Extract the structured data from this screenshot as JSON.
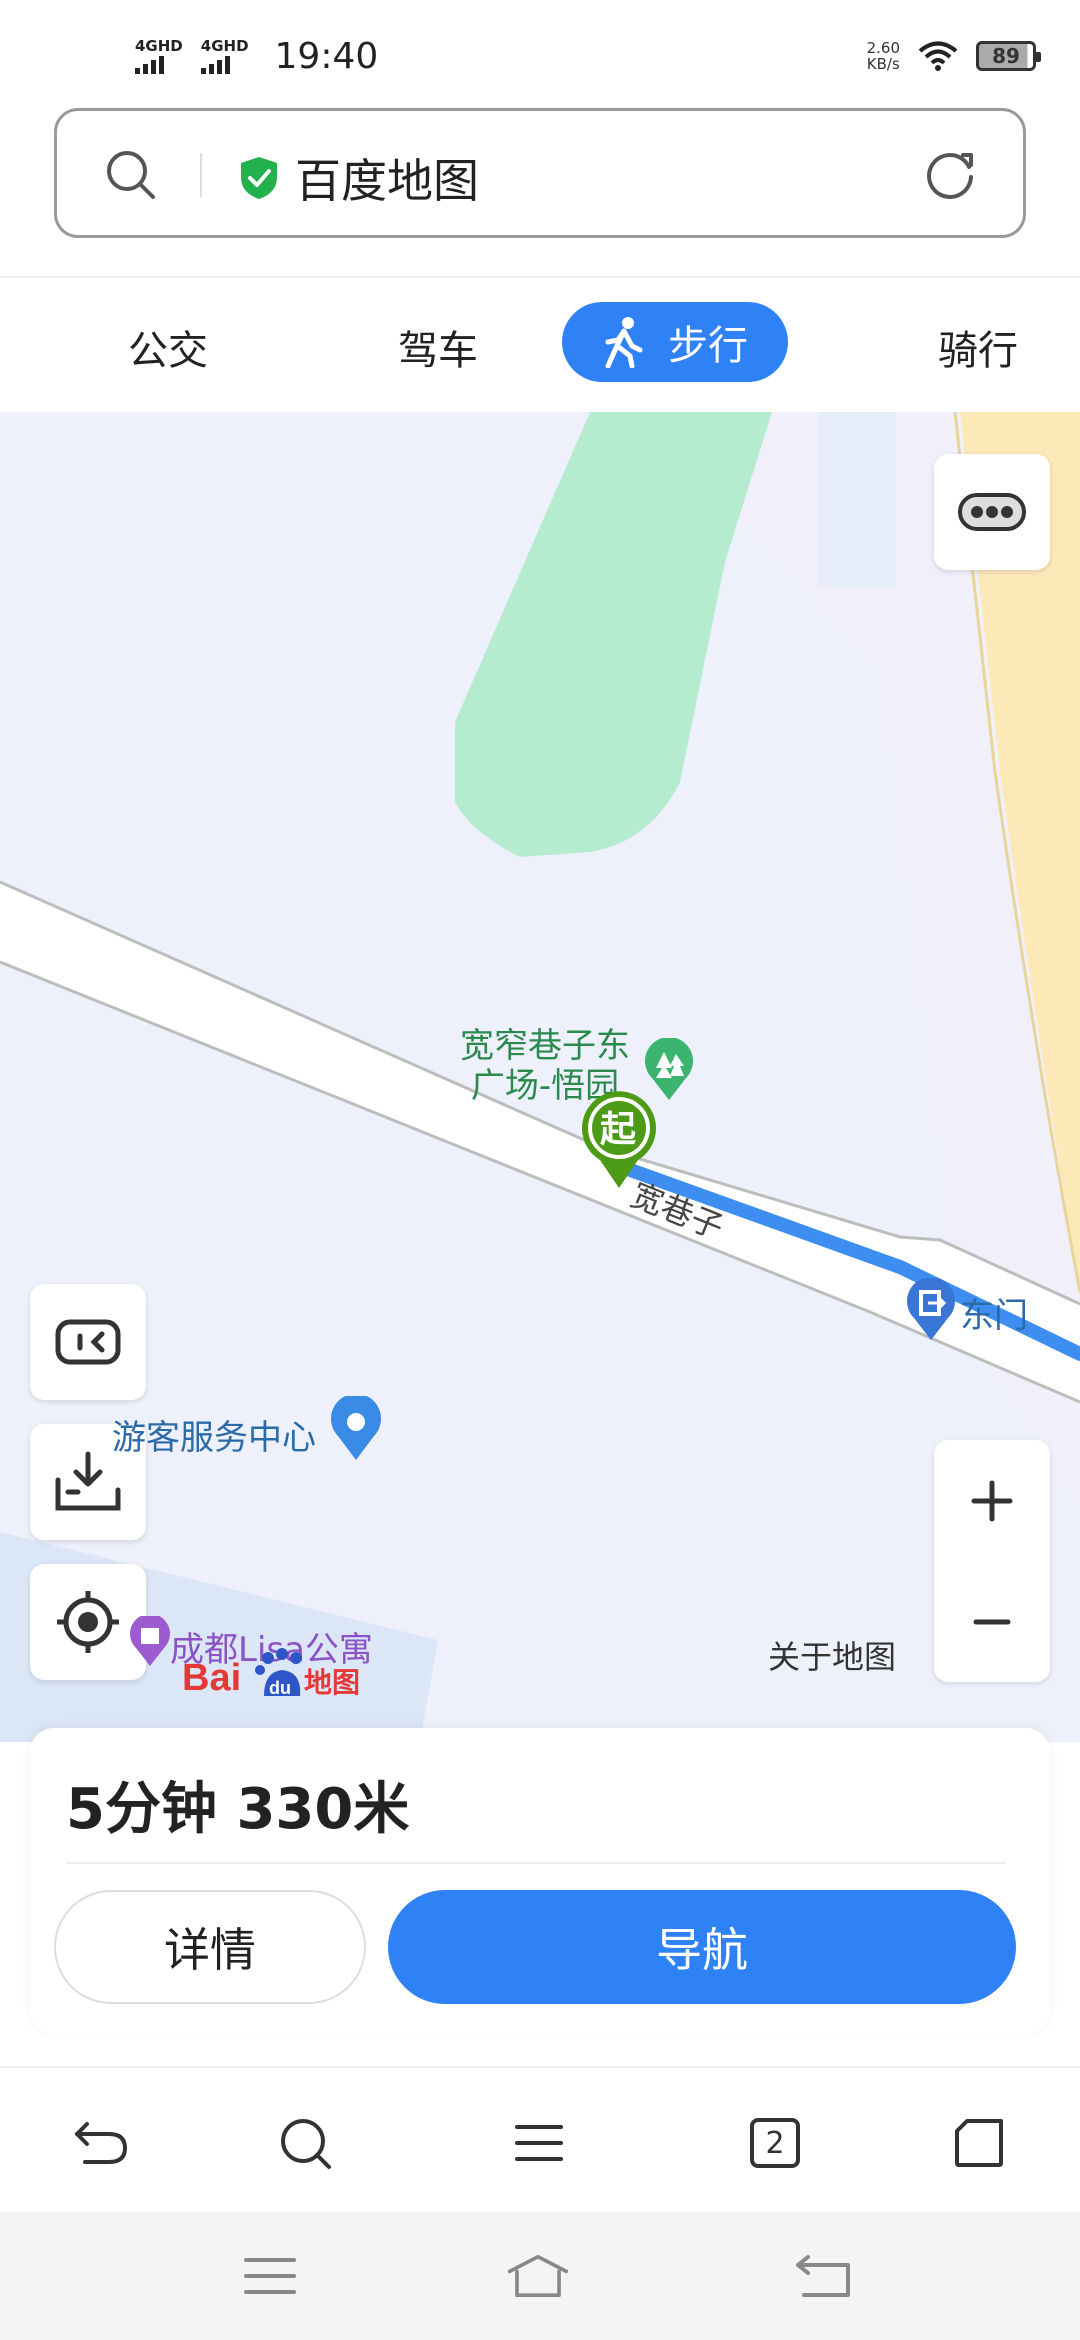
{
  "status_bar": {
    "signal1": "4GHD",
    "signal2": "4GHD",
    "time": "19:40",
    "speed_value": "2.60",
    "speed_unit": "KB/s",
    "battery": "89"
  },
  "search": {
    "title": "百度地图"
  },
  "tabs": {
    "bus": "公交",
    "drive": "驾车",
    "walk": "步行",
    "ride": "骑行"
  },
  "map": {
    "poi_square_line1": "宽窄巷子东",
    "poi_square_line2": "广场-悟园",
    "start_marker": "起",
    "road_name": "宽巷子",
    "east_gate": "东门",
    "visitor_center": "游客服务中心",
    "apartment": "成都Lisa公寓",
    "about_map": "关于地图",
    "logo_text": "Bai地图"
  },
  "route": {
    "summary": "5分钟  330米",
    "detail_label": "详情",
    "navigate_label": "导航"
  },
  "toolbar": {
    "tab_count": "2"
  },
  "colors": {
    "accent": "#2e82f6",
    "park_green": "#b5ebcf",
    "road_yellow": "#fde8b8",
    "start_green": "#4c9a16"
  }
}
